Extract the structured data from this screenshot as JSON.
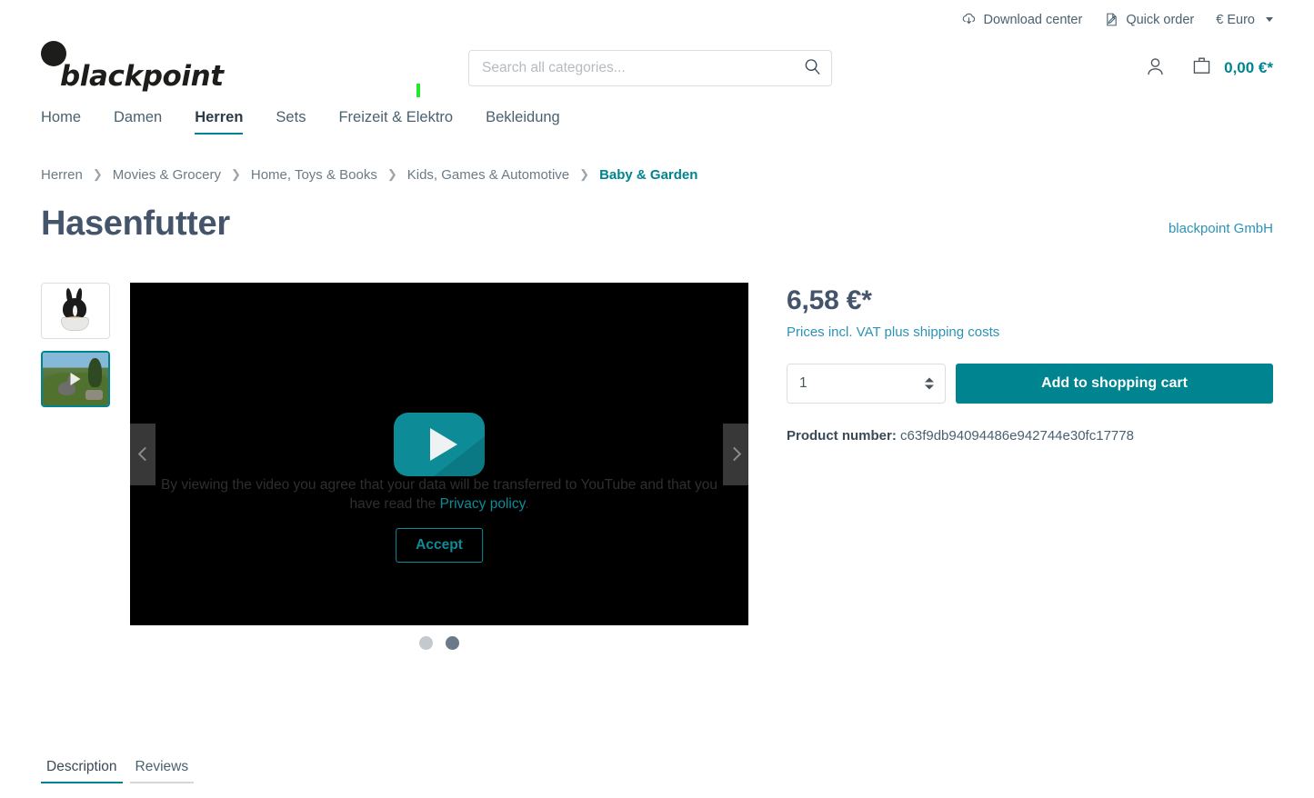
{
  "topbar": {
    "download_center": "Download center",
    "quick_order": "Quick order",
    "currency": "€ Euro"
  },
  "header": {
    "logo_text": "blackpoint",
    "search_placeholder": "Search all categories...",
    "cart_total": "0,00 €*"
  },
  "nav": {
    "items": [
      {
        "label": "Home",
        "active": false
      },
      {
        "label": "Damen",
        "active": false
      },
      {
        "label": "Herren",
        "active": true
      },
      {
        "label": "Sets",
        "active": false
      },
      {
        "label": "Freizeit & Elektro",
        "active": false
      },
      {
        "label": "Bekleidung",
        "active": false
      }
    ]
  },
  "breadcrumb": {
    "items": [
      {
        "label": "Herren",
        "current": false
      },
      {
        "label": "Movies & Grocery",
        "current": false
      },
      {
        "label": "Home, Toys & Books",
        "current": false
      },
      {
        "label": "Kids, Games & Automotive",
        "current": false
      },
      {
        "label": "Baby & Garden",
        "current": true
      }
    ]
  },
  "product": {
    "title": "Hasenfutter",
    "manufacturer": "blackpoint GmbH",
    "price": "6,58 €*",
    "tax_note": "Prices incl. VAT plus shipping costs",
    "quantity_value": "1",
    "add_to_cart_label": "Add to shopping cart",
    "product_number_label": "Product number:",
    "product_number_value": "c63f9db94094486e942744e30fc17778"
  },
  "gallery": {
    "thumbs": [
      {
        "name": "rabbit-photo-thumbnail",
        "active": false
      },
      {
        "name": "video-thumbnail",
        "active": true
      }
    ],
    "dots": [
      {
        "active": false
      },
      {
        "active": true
      }
    ],
    "prev_label": "Previous",
    "next_label": "Next"
  },
  "video_consent": {
    "message_before": "By viewing the video you agree that your data will be transferred to YouTube and that you have read the ",
    "link_label": "Privacy policy",
    "message_after": ".",
    "accept_label": "Accept"
  },
  "tabs": {
    "items": [
      {
        "label": "Description",
        "active": true
      },
      {
        "label": "Reviews",
        "active": false
      }
    ]
  },
  "colors": {
    "accent_teal": "#008490",
    "link_blue": "#2d93b5",
    "text_dark": "#44546b",
    "flag_green": "#25e82a"
  }
}
